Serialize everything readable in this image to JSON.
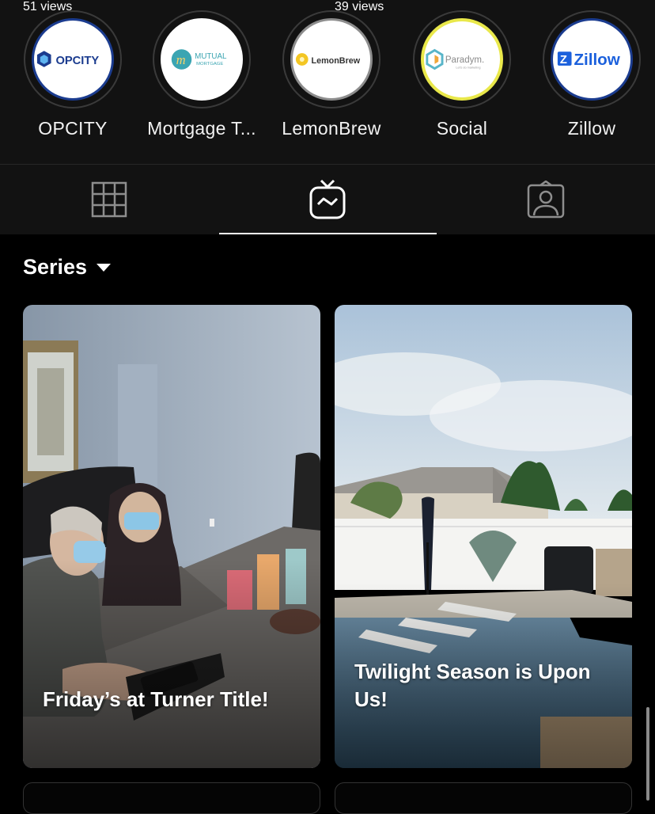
{
  "highlights": [
    {
      "label": "OPCITY",
      "logo_text": "OPCITY",
      "ring_color": "#1b3c8f"
    },
    {
      "label": "Mortgage T...",
      "logo_text": "MUTUAL",
      "logo_subtext": "MORTGAGE",
      "ring_color": "#ffffff"
    },
    {
      "label": "LemonBrew",
      "logo_text": "LemonBrew",
      "ring_color": "#8d8d8d"
    },
    {
      "label": "Social",
      "logo_text": "Paradym.",
      "logo_subtext": "Let's do marketing",
      "ring_color": "#e9e84a"
    },
    {
      "label": "Zillow",
      "logo_text": "Zillow",
      "ring_color": "#1b3c8f"
    }
  ],
  "tabs": [
    {
      "name": "grid",
      "icon": "grid-icon"
    },
    {
      "name": "igtv",
      "icon": "igtv-icon",
      "active": true
    },
    {
      "name": "tagged",
      "icon": "tagged-icon"
    }
  ],
  "series": {
    "label": "Series"
  },
  "cards": [
    {
      "title": "Friday’s at Turner Title!",
      "views": "51 views"
    },
    {
      "title": "Twilight Season is Upon Us!",
      "views": "39 views"
    }
  ],
  "colors": {
    "background": "#000000",
    "panel": "#121212",
    "opcity_blue": "#1b3c8f",
    "zillow_blue": "#1b60dc",
    "lemon_yellow": "#f3c623",
    "mutual_teal": "#3ba5b2"
  }
}
